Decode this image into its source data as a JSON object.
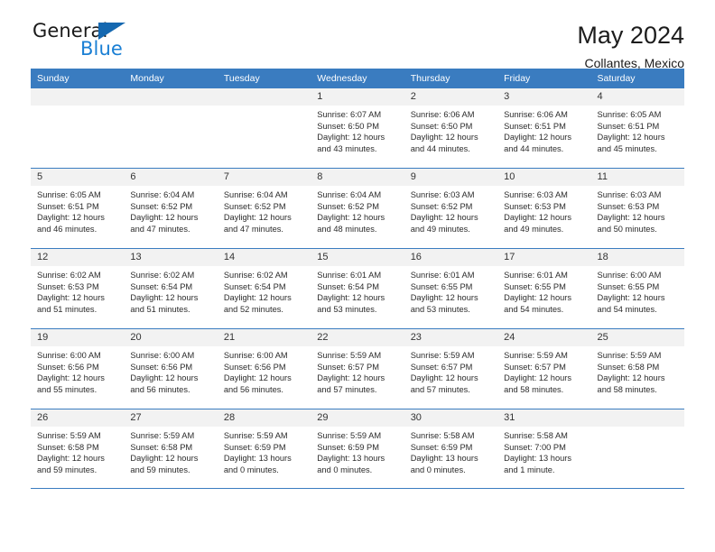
{
  "logo": {
    "word_top": "General",
    "word_bottom": "Blue",
    "triangle_icon": "triangle-icon",
    "accent_dark": "#1568b0",
    "accent_blue": "#1a7fd4"
  },
  "header": {
    "title": "May 2024",
    "subtitle": "Collantes, Mexico"
  },
  "colors": {
    "header_blue": "#3a7cc0",
    "day_band_gray": "#f2f2f2",
    "text": "#2b2b2b"
  },
  "weekdays": [
    "Sunday",
    "Monday",
    "Tuesday",
    "Wednesday",
    "Thursday",
    "Friday",
    "Saturday"
  ],
  "weeks": [
    [
      {
        "day": "",
        "sunrise": "",
        "sunset": "",
        "daylight_line1": "",
        "daylight_line2": ""
      },
      {
        "day": "",
        "sunrise": "",
        "sunset": "",
        "daylight_line1": "",
        "daylight_line2": ""
      },
      {
        "day": "",
        "sunrise": "",
        "sunset": "",
        "daylight_line1": "",
        "daylight_line2": ""
      },
      {
        "day": "1",
        "sunrise": "Sunrise: 6:07 AM",
        "sunset": "Sunset: 6:50 PM",
        "daylight_line1": "Daylight: 12 hours",
        "daylight_line2": "and 43 minutes."
      },
      {
        "day": "2",
        "sunrise": "Sunrise: 6:06 AM",
        "sunset": "Sunset: 6:50 PM",
        "daylight_line1": "Daylight: 12 hours",
        "daylight_line2": "and 44 minutes."
      },
      {
        "day": "3",
        "sunrise": "Sunrise: 6:06 AM",
        "sunset": "Sunset: 6:51 PM",
        "daylight_line1": "Daylight: 12 hours",
        "daylight_line2": "and 44 minutes."
      },
      {
        "day": "4",
        "sunrise": "Sunrise: 6:05 AM",
        "sunset": "Sunset: 6:51 PM",
        "daylight_line1": "Daylight: 12 hours",
        "daylight_line2": "and 45 minutes."
      }
    ],
    [
      {
        "day": "5",
        "sunrise": "Sunrise: 6:05 AM",
        "sunset": "Sunset: 6:51 PM",
        "daylight_line1": "Daylight: 12 hours",
        "daylight_line2": "and 46 minutes."
      },
      {
        "day": "6",
        "sunrise": "Sunrise: 6:04 AM",
        "sunset": "Sunset: 6:52 PM",
        "daylight_line1": "Daylight: 12 hours",
        "daylight_line2": "and 47 minutes."
      },
      {
        "day": "7",
        "sunrise": "Sunrise: 6:04 AM",
        "sunset": "Sunset: 6:52 PM",
        "daylight_line1": "Daylight: 12 hours",
        "daylight_line2": "and 47 minutes."
      },
      {
        "day": "8",
        "sunrise": "Sunrise: 6:04 AM",
        "sunset": "Sunset: 6:52 PM",
        "daylight_line1": "Daylight: 12 hours",
        "daylight_line2": "and 48 minutes."
      },
      {
        "day": "9",
        "sunrise": "Sunrise: 6:03 AM",
        "sunset": "Sunset: 6:52 PM",
        "daylight_line1": "Daylight: 12 hours",
        "daylight_line2": "and 49 minutes."
      },
      {
        "day": "10",
        "sunrise": "Sunrise: 6:03 AM",
        "sunset": "Sunset: 6:53 PM",
        "daylight_line1": "Daylight: 12 hours",
        "daylight_line2": "and 49 minutes."
      },
      {
        "day": "11",
        "sunrise": "Sunrise: 6:03 AM",
        "sunset": "Sunset: 6:53 PM",
        "daylight_line1": "Daylight: 12 hours",
        "daylight_line2": "and 50 minutes."
      }
    ],
    [
      {
        "day": "12",
        "sunrise": "Sunrise: 6:02 AM",
        "sunset": "Sunset: 6:53 PM",
        "daylight_line1": "Daylight: 12 hours",
        "daylight_line2": "and 51 minutes."
      },
      {
        "day": "13",
        "sunrise": "Sunrise: 6:02 AM",
        "sunset": "Sunset: 6:54 PM",
        "daylight_line1": "Daylight: 12 hours",
        "daylight_line2": "and 51 minutes."
      },
      {
        "day": "14",
        "sunrise": "Sunrise: 6:02 AM",
        "sunset": "Sunset: 6:54 PM",
        "daylight_line1": "Daylight: 12 hours",
        "daylight_line2": "and 52 minutes."
      },
      {
        "day": "15",
        "sunrise": "Sunrise: 6:01 AM",
        "sunset": "Sunset: 6:54 PM",
        "daylight_line1": "Daylight: 12 hours",
        "daylight_line2": "and 53 minutes."
      },
      {
        "day": "16",
        "sunrise": "Sunrise: 6:01 AM",
        "sunset": "Sunset: 6:55 PM",
        "daylight_line1": "Daylight: 12 hours",
        "daylight_line2": "and 53 minutes."
      },
      {
        "day": "17",
        "sunrise": "Sunrise: 6:01 AM",
        "sunset": "Sunset: 6:55 PM",
        "daylight_line1": "Daylight: 12 hours",
        "daylight_line2": "and 54 minutes."
      },
      {
        "day": "18",
        "sunrise": "Sunrise: 6:00 AM",
        "sunset": "Sunset: 6:55 PM",
        "daylight_line1": "Daylight: 12 hours",
        "daylight_line2": "and 54 minutes."
      }
    ],
    [
      {
        "day": "19",
        "sunrise": "Sunrise: 6:00 AM",
        "sunset": "Sunset: 6:56 PM",
        "daylight_line1": "Daylight: 12 hours",
        "daylight_line2": "and 55 minutes."
      },
      {
        "day": "20",
        "sunrise": "Sunrise: 6:00 AM",
        "sunset": "Sunset: 6:56 PM",
        "daylight_line1": "Daylight: 12 hours",
        "daylight_line2": "and 56 minutes."
      },
      {
        "day": "21",
        "sunrise": "Sunrise: 6:00 AM",
        "sunset": "Sunset: 6:56 PM",
        "daylight_line1": "Daylight: 12 hours",
        "daylight_line2": "and 56 minutes."
      },
      {
        "day": "22",
        "sunrise": "Sunrise: 5:59 AM",
        "sunset": "Sunset: 6:57 PM",
        "daylight_line1": "Daylight: 12 hours",
        "daylight_line2": "and 57 minutes."
      },
      {
        "day": "23",
        "sunrise": "Sunrise: 5:59 AM",
        "sunset": "Sunset: 6:57 PM",
        "daylight_line1": "Daylight: 12 hours",
        "daylight_line2": "and 57 minutes."
      },
      {
        "day": "24",
        "sunrise": "Sunrise: 5:59 AM",
        "sunset": "Sunset: 6:57 PM",
        "daylight_line1": "Daylight: 12 hours",
        "daylight_line2": "and 58 minutes."
      },
      {
        "day": "25",
        "sunrise": "Sunrise: 5:59 AM",
        "sunset": "Sunset: 6:58 PM",
        "daylight_line1": "Daylight: 12 hours",
        "daylight_line2": "and 58 minutes."
      }
    ],
    [
      {
        "day": "26",
        "sunrise": "Sunrise: 5:59 AM",
        "sunset": "Sunset: 6:58 PM",
        "daylight_line1": "Daylight: 12 hours",
        "daylight_line2": "and 59 minutes."
      },
      {
        "day": "27",
        "sunrise": "Sunrise: 5:59 AM",
        "sunset": "Sunset: 6:58 PM",
        "daylight_line1": "Daylight: 12 hours",
        "daylight_line2": "and 59 minutes."
      },
      {
        "day": "28",
        "sunrise": "Sunrise: 5:59 AM",
        "sunset": "Sunset: 6:59 PM",
        "daylight_line1": "Daylight: 13 hours",
        "daylight_line2": "and 0 minutes."
      },
      {
        "day": "29",
        "sunrise": "Sunrise: 5:59 AM",
        "sunset": "Sunset: 6:59 PM",
        "daylight_line1": "Daylight: 13 hours",
        "daylight_line2": "and 0 minutes."
      },
      {
        "day": "30",
        "sunrise": "Sunrise: 5:58 AM",
        "sunset": "Sunset: 6:59 PM",
        "daylight_line1": "Daylight: 13 hours",
        "daylight_line2": "and 0 minutes."
      },
      {
        "day": "31",
        "sunrise": "Sunrise: 5:58 AM",
        "sunset": "Sunset: 7:00 PM",
        "daylight_line1": "Daylight: 13 hours",
        "daylight_line2": "and 1 minute."
      },
      {
        "day": "",
        "sunrise": "",
        "sunset": "",
        "daylight_line1": "",
        "daylight_line2": ""
      }
    ]
  ]
}
